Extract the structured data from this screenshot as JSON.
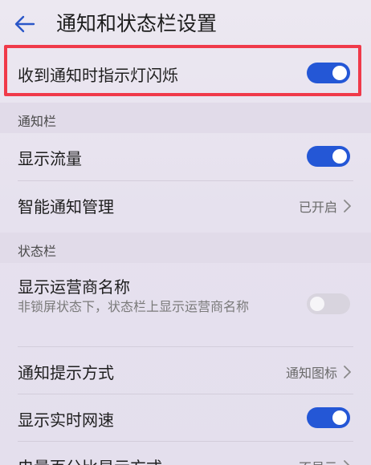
{
  "header": {
    "title": "通知和状态栏设置"
  },
  "rows": {
    "notify_light": {
      "label": "收到通知时指示灯闪烁",
      "state": "on"
    },
    "show_traffic": {
      "label": "显示流量",
      "state": "on"
    },
    "smart_notify": {
      "label": "智能通知管理",
      "value": "已开启"
    },
    "show_carrier": {
      "label": "显示运营商名称",
      "sub": "非锁屏状态下，状态栏上显示运营商名称",
      "state": "off"
    },
    "notify_style": {
      "label": "通知提示方式",
      "value": "通知图标"
    },
    "show_speed": {
      "label": "显示实时网速",
      "state": "on"
    },
    "battery_percent": {
      "label": "电量百分比显示方式",
      "value": "不显示"
    }
  },
  "sections": {
    "notification_bar": "通知栏",
    "status_bar": "状态栏"
  },
  "colors": {
    "accent": "#2457d6",
    "highlight": "#f03a4a",
    "toggle_off": "#d8d4de"
  },
  "icons": {
    "back": "back-arrow-icon",
    "chevron": "chevron-right-icon"
  }
}
